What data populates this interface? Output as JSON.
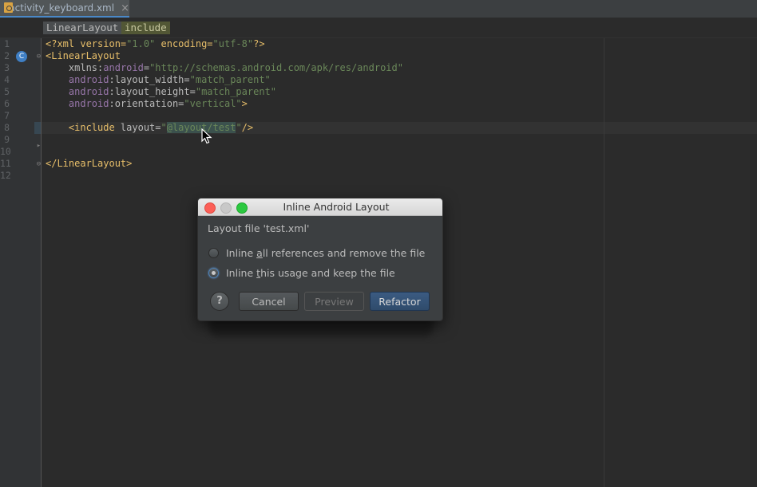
{
  "tab": {
    "file_name": "activity_keyboard.xml",
    "close_glyph": "×",
    "icon": "xml-file-icon"
  },
  "breadcrumbs": [
    "LinearLayout",
    "include"
  ],
  "gutter": {
    "line_numbers": [
      "1",
      "2",
      "3",
      "4",
      "5",
      "6",
      "7",
      "8",
      "9",
      "10",
      "11",
      "12"
    ],
    "marker_label": "C"
  },
  "code": {
    "l1": {
      "a": "<?xml version=",
      "b": "\"1.0\"",
      "c": " encoding=",
      "d": "\"utf-8\"",
      "e": "?>"
    },
    "l2": {
      "a": "<LinearLayout"
    },
    "l3": {
      "indent": "    ",
      "a": "xmlns:",
      "b": "android",
      "c": "=",
      "d": "\"http://schemas.android.com/apk/res/android\""
    },
    "l4": {
      "indent": "    ",
      "a": "android",
      "b": ":layout_width=",
      "c": "\"match_parent\""
    },
    "l5": {
      "indent": "    ",
      "a": "android",
      "b": ":layout_height=",
      "c": "\"match_parent\""
    },
    "l6": {
      "indent": "    ",
      "a": "android",
      "b": ":orientation=",
      "c": "\"vertical\"",
      "d": ">"
    },
    "l8": {
      "indent": "    ",
      "a": "<include",
      "b": " layout=",
      "c": "\"",
      "d": "@layout/test",
      "e": "\"",
      "f": "/>"
    },
    "l11": {
      "a": "</LinearLayout>"
    }
  },
  "dialog": {
    "title": "Inline Android Layout",
    "message": "Layout file 'test.xml'",
    "option1": {
      "pre": "Inline ",
      "mn": "a",
      "post": "ll references and remove the file",
      "checked": false
    },
    "option2": {
      "pre": "Inline ",
      "mn": "t",
      "post": "his usage and keep the file",
      "checked": true
    },
    "help": "?",
    "cancel": "Cancel",
    "preview": "Preview",
    "refactor": "Refactor"
  },
  "colors": {
    "editor_bg": "#2b2b2b",
    "tag": "#e8bf6a",
    "string": "#6a8759",
    "namespace": "#9876aa",
    "accent": "#4a88c7"
  }
}
